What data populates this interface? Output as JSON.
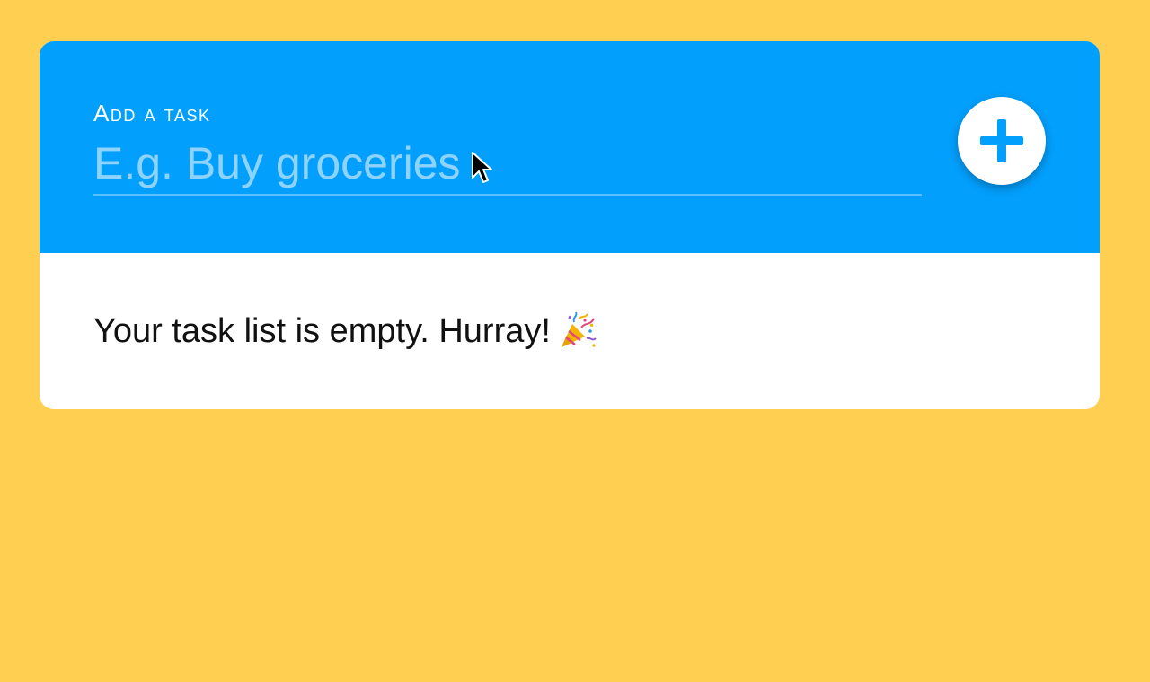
{
  "colors": {
    "page_background": "#FECF51",
    "header_background": "#039FFC",
    "card_background": "#FFFFFF",
    "add_icon": "#039FFC"
  },
  "add_task": {
    "label": "Add a task",
    "placeholder": "E.g. Buy groceries",
    "value": "",
    "add_button_icon": "plus-icon"
  },
  "task_list": {
    "empty_message": "Your task list is empty. Hurray!",
    "empty_icon": "party-popper-icon"
  }
}
